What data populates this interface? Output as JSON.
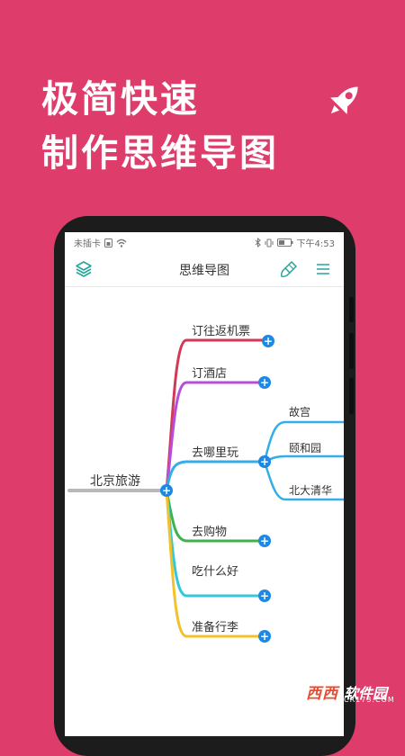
{
  "headline": {
    "line1": "极简快速",
    "line2": "制作思维导图",
    "icon": "rocket-icon"
  },
  "status_bar": {
    "carrier": "未插卡",
    "time": "下午4:53"
  },
  "app_bar": {
    "title": "思维导图",
    "left_icon": "layers-icon",
    "right_icons": [
      "brush-icon",
      "menu-icon"
    ],
    "accent": "#26a69a"
  },
  "mindmap": {
    "root": "北京旅游",
    "branches": [
      {
        "label": "订往返机票",
        "color": "#d23a54"
      },
      {
        "label": "订酒店",
        "color": "#b84ed8"
      },
      {
        "label": "去哪里玩",
        "color": "#33aee6",
        "children": [
          "故宫",
          "颐和园",
          "北大清华"
        ]
      },
      {
        "label": "去购物",
        "color": "#3fb24f"
      },
      {
        "label": "吃什么好",
        "color": "#33c8da"
      },
      {
        "label": "准备行李",
        "color": "#f2c22b"
      }
    ],
    "add_symbol": "+"
  },
  "watermark": {
    "brand": "西西",
    "software": "软件园",
    "url": "CR173.COM"
  }
}
